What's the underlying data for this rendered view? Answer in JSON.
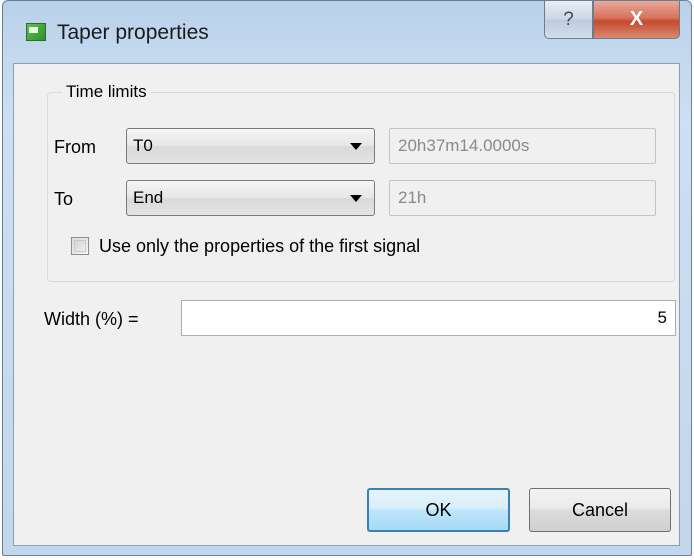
{
  "window": {
    "title": "Taper properties",
    "help_label": "?",
    "close_label": "X"
  },
  "time_limits": {
    "group_title": "Time limits",
    "from": {
      "label": "From",
      "selected": "T0",
      "value": "20h37m14.0000s"
    },
    "to": {
      "label": "To",
      "selected": "End",
      "value": "21h"
    },
    "checkbox": {
      "label": "Use only the properties of the first signal",
      "checked": false
    }
  },
  "width": {
    "label": "Width (%) =",
    "value": "5"
  },
  "buttons": {
    "ok": "OK",
    "cancel": "Cancel"
  },
  "colors": {
    "ok_border": "#3c7fb1",
    "close_button": "#c44a2f"
  }
}
